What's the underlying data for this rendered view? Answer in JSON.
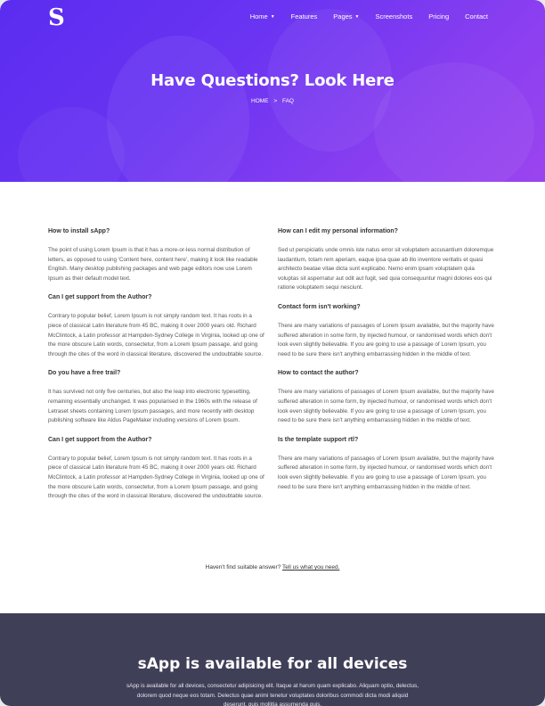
{
  "brand": {
    "logo_letter": "S"
  },
  "nav": {
    "items": [
      {
        "label": "Home",
        "dropdown": true
      },
      {
        "label": "Features",
        "dropdown": false
      },
      {
        "label": "Pages",
        "dropdown": true
      },
      {
        "label": "Screenshots",
        "dropdown": false
      },
      {
        "label": "Pricing",
        "dropdown": false
      },
      {
        "label": "Contact",
        "dropdown": false
      }
    ]
  },
  "hero": {
    "title": "Have Questions? Look Here",
    "breadcrumb": {
      "home": "HOME",
      "separator": ">",
      "current": "FAQ"
    }
  },
  "faq": {
    "left": [
      {
        "question": "How to install sApp?",
        "answer": "The point of using Lorem Ipsum is that it has a more-or-less normal distribution of letters, as opposed to using 'Content here, content here', making it look like readable English. Many desktop publishing packages and web page editors now use Lorem Ipsum as their default model text."
      },
      {
        "question": "Can I get support from the Author?",
        "answer": "Contrary to popular belief, Lorem Ipsum is not simply random text. It has roots in a piece of classical Latin literature from 45 BC, making it over 2000 years old. Richard McClintock, a Latin professor at Hampden-Sydney College in Virginia, looked up one of the more obscure Latin words, consectetur, from a Lorem Ipsum passage, and going through the cites of the word in classical literature, discovered the undoubtable source."
      },
      {
        "question": "Do you have a free trail?",
        "answer": "It has survived not only five centuries, but also the leap into electronic typesetting, remaining essentially unchanged. It was popularised in the 1960s with the release of Letraset sheets containing Lorem Ipsum passages, and more recently with desktop publishing software like Aldus PageMaker including versions of Lorem Ipsum."
      },
      {
        "question": "Can I get support from the Author?",
        "answer": "Contrary to popular belief, Lorem Ipsum is not simply random text. It has roots in a piece of classical Latin literature from 45 BC, making it over 2000 years old. Richard McClintock, a Latin professor at Hampden-Sydney College in Virginia, looked up one of the more obscure Latin words, consectetur, from a Lorem Ipsum passage, and going through the cites of the word in classical literature, discovered the undoubtable source."
      }
    ],
    "right": [
      {
        "question": "How can I edit my personal information?",
        "answer": "Sed ut perspiciatis unde omnis iste natus error sit voluptatem accusantium doloremque laudantium, totam rem aperiam, eaque ipsa quae ab illo inventore veritatis et quasi architecto beatae vitae dicta sunt explicabo. Nemo enim ipsam voluptatem quia voluptas sit aspernatur aut odit aut fugit, sed quia consequuntur magni dolores eos qui ratione voluptatem sequi nesciunt."
      },
      {
        "question": "Contact form isn't working?",
        "answer": "There are many variations of passages of Lorem Ipsum available, but the majority have suffered alteration in some form, by injected humour, or randomised words which don't look even slightly believable. If you are going to use a passage of Lorem Ipsum, you need to be sure there isn't anything embarrassing hidden in the middle of text."
      },
      {
        "question": "How to contact the author?",
        "answer": "There are many variations of passages of Lorem Ipsum available, but the majority have suffered alteration in some form, by injected humour, or randomised words which don't look even slightly believable. If you are going to use a passage of Lorem Ipsum, you need to be sure there isn't anything embarrassing hidden in the middle of text."
      },
      {
        "question": "Is the template support rtl?",
        "answer": "There are many variations of passages of Lorem Ipsum available, but the majority have suffered alteration in some form, by injected humour, or randomised words which don't look even slightly believable. If you are going to use a passage of Lorem Ipsum, you need to be sure there isn't anything embarrassing hidden in the middle of text."
      }
    ],
    "cta": {
      "text": "Haven't find suitable answer?",
      "link": "Tell us what you need."
    }
  },
  "devices": {
    "title": "sApp is available for all devices",
    "text": "sApp is available for all devices, consectetur adipisicing elit. Itaque at harum quam explicabo. Aliquam optio, delectus, dolorem quod neque eos totam. Delectus quae animi tenetur voluptates doloribus commodi dicta modi aliquid deserunt, quis mollitia assumenda quis."
  },
  "colors": {
    "hero_start": "#5b2cf0",
    "hero_end": "#9a44ef",
    "devices_bg": "#403f58"
  }
}
